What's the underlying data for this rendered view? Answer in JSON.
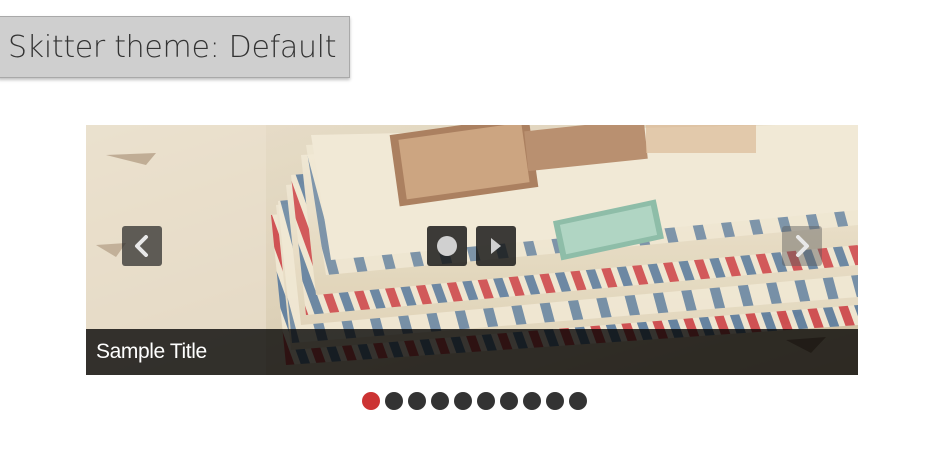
{
  "theme_label": "Skitter theme: Default",
  "slider": {
    "caption": "Sample Title",
    "pager": {
      "count": 10,
      "active_index": 0
    },
    "colors": {
      "pager_active": "#cc3333",
      "pager_inactive": "#333333"
    },
    "controls": {
      "prev_icon": "chevron-left-icon",
      "next_icon": "chevron-right-icon",
      "play_pause_icon": "circle-icon",
      "focus_icon": "play-triangle-icon"
    }
  }
}
